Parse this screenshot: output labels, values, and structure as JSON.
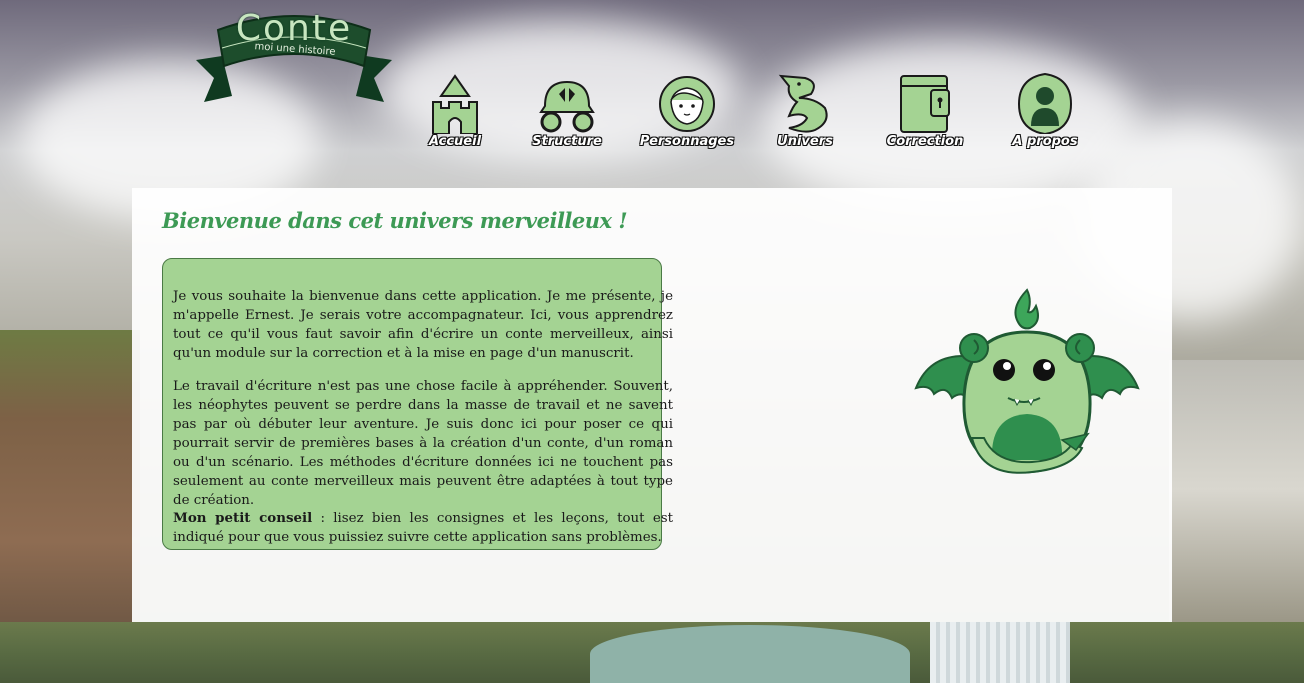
{
  "logo": {
    "title": "Conte",
    "subtitle": "moi une histoire"
  },
  "nav": [
    {
      "label": "Accueil",
      "icon": "castle-icon"
    },
    {
      "label": "Structure",
      "icon": "carriage-icon"
    },
    {
      "label": "Personnages",
      "icon": "princess-face-icon"
    },
    {
      "label": "Univers",
      "icon": "dragon-icon"
    },
    {
      "label": "Correction",
      "icon": "locked-book-icon"
    },
    {
      "label": "A propos",
      "icon": "silhouette-icon"
    }
  ],
  "panel": {
    "title": "Bienvenue dans cet univers merveilleux !",
    "paragraph1": "Je vous souhaite la bienvenue dans cette application. Je me présente, je m'appelle Ernest. Je serais votre accompagnateur. Ici, vous apprendrez tout ce qu'il vous faut savoir afin d'écrire un conte merveilleux, ainsi qu'un module sur la correction et à la mise en page d'un manuscrit.",
    "paragraph2": "Le travail d'écriture n'est pas une chose facile à appréhender. Souvent, les néophytes peuvent se perdre dans la masse de travail et ne savent pas par où débuter leur aventure. Je suis donc ici pour poser ce qui pourrait servir de premières bases à la création d'un conte, d'un roman ou d'un scénario. Les méthodes d'écriture données ici ne touchent pas seulement au conte merveilleux mais peuvent être adaptées à tout type de création.",
    "tip_label": "Mon petit conseil",
    "tip_text": " : lisez bien les consignes et les leçons, tout est indiqué pour que vous puissiez suivre cette application sans problèmes."
  },
  "colors": {
    "accent": "#3d9a55",
    "box": "#a4d393",
    "dark_green": "#1f5a33"
  }
}
